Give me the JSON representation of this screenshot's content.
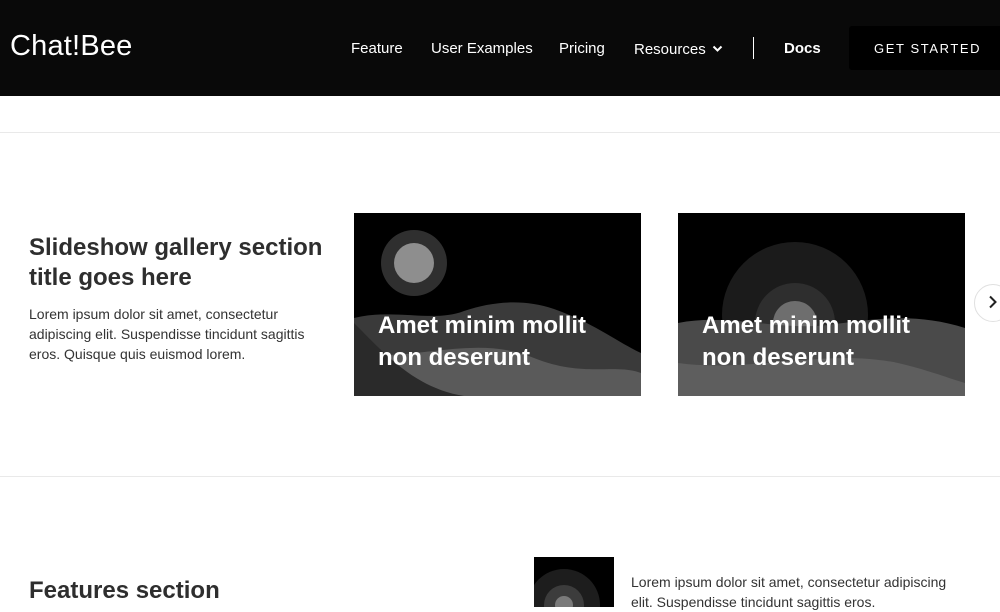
{
  "nav": {
    "brand": "Chat!Bee",
    "links": [
      "Feature",
      "User Examples",
      "Pricing",
      "Resources"
    ],
    "resources_chevron_icon": "chevron-down-icon",
    "docs": "Docs",
    "cta": "GET STARTED"
  },
  "gallery": {
    "title": "Slideshow gallery section title goes here",
    "description": "Lorem ipsum dolor sit amet, consectetur adipiscing elit. Suspendisse tincidunt sagittis eros. Quisque quis euismod lorem.",
    "cards": [
      {
        "caption": "Amet minim mollit non deserunt"
      },
      {
        "caption": "Amet minim mollit non deserunt"
      }
    ],
    "next_icon": "chevron-right-icon"
  },
  "features": {
    "title": "Features section",
    "item_text": "Lorem ipsum dolor sit amet, consectetur adipiscing elit. Suspendisse tincidunt sagittis eros."
  }
}
